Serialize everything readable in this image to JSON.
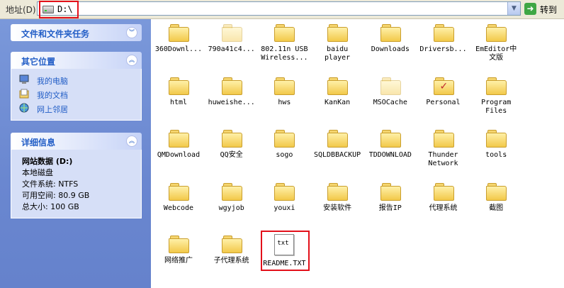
{
  "address_bar": {
    "label": "地址(D)",
    "path": "D:\\",
    "dropdown_icon": "chevron-down-icon",
    "go_label": "转到",
    "go_icon": "go-arrow-icon"
  },
  "tasks_panel": {
    "title": "文件和文件夹任务",
    "state_icon": "double-chevron-down-icon"
  },
  "places_panel": {
    "title": "其它位置",
    "state_icon": "double-chevron-up-icon",
    "items": [
      {
        "label": "我的电脑",
        "icon": "computer-icon"
      },
      {
        "label": "我的文档",
        "icon": "documents-icon"
      },
      {
        "label": "网上邻居",
        "icon": "network-icon"
      }
    ]
  },
  "details_panel": {
    "title": "详细信息",
    "state_icon": "double-chevron-up-icon",
    "name": "网站数据 (D:)",
    "type": "本地磁盘",
    "filesystem": "文件系统: NTFS",
    "free": "可用空间: 80.9 GB",
    "total": "总大小: 100 GB"
  },
  "files": [
    {
      "label": "360Downl...",
      "kind": "folder"
    },
    {
      "label": "790a41c4...",
      "kind": "folder-hidden"
    },
    {
      "label": "802.11n USB\nWireless...",
      "kind": "folder"
    },
    {
      "label": "baidu\nplayer",
      "kind": "folder"
    },
    {
      "label": "Downloads",
      "kind": "folder"
    },
    {
      "label": "Driversb...",
      "kind": "folder"
    },
    {
      "label": "EmEditor中\n文版",
      "kind": "folder"
    },
    {
      "label": "html",
      "kind": "folder"
    },
    {
      "label": "huweishe...",
      "kind": "folder"
    },
    {
      "label": "hws",
      "kind": "folder"
    },
    {
      "label": "KanKan",
      "kind": "folder"
    },
    {
      "label": "MSOCache",
      "kind": "folder-hidden"
    },
    {
      "label": "Personal",
      "kind": "folder-personal"
    },
    {
      "label": "Program\nFiles",
      "kind": "folder"
    },
    {
      "label": "QMDownload",
      "kind": "folder"
    },
    {
      "label": "QQ安全",
      "kind": "folder"
    },
    {
      "label": "sogo",
      "kind": "folder"
    },
    {
      "label": "SQLDBBACKUP",
      "kind": "folder"
    },
    {
      "label": "TDDOWNLOAD",
      "kind": "folder"
    },
    {
      "label": "Thunder\nNetwork",
      "kind": "folder"
    },
    {
      "label": "tools",
      "kind": "folder"
    },
    {
      "label": "Webcode",
      "kind": "folder"
    },
    {
      "label": "wgyjob",
      "kind": "folder"
    },
    {
      "label": "youxi",
      "kind": "folder"
    },
    {
      "label": "安装软件",
      "kind": "folder"
    },
    {
      "label": "报告IP",
      "kind": "folder"
    },
    {
      "label": "代理系统",
      "kind": "folder"
    },
    {
      "label": "截图",
      "kind": "folder"
    },
    {
      "label": "网络推广",
      "kind": "folder"
    },
    {
      "label": "子代理系统",
      "kind": "folder"
    },
    {
      "label": "README.TXT",
      "kind": "text-file",
      "icon_text": "txt"
    }
  ],
  "colors": {
    "highlight": "#e3101a",
    "pane": "#6a87d0",
    "link": "#215dc6"
  }
}
